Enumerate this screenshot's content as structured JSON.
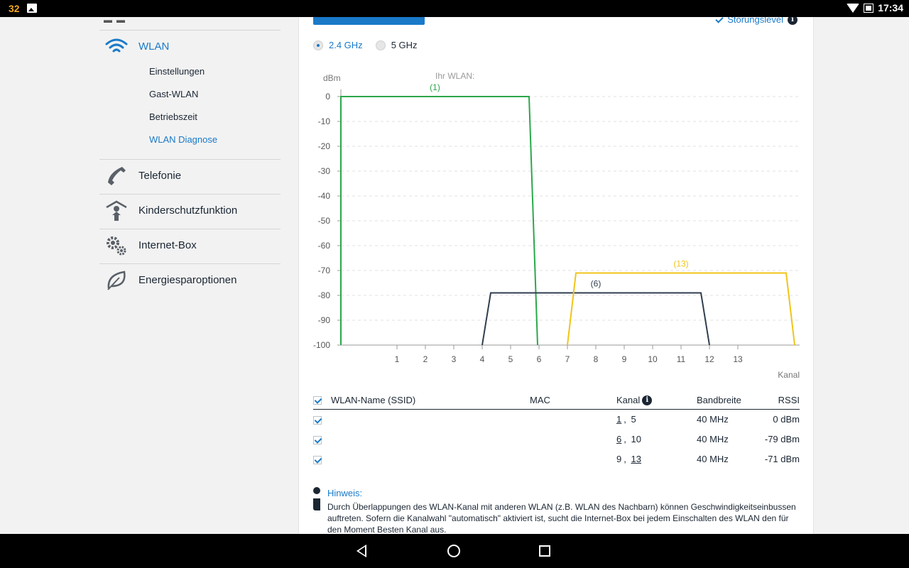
{
  "status_bar": {
    "notification_count": "32",
    "time": "17:34"
  },
  "sidebar": {
    "wlan": {
      "label": "WLAN",
      "sub_items": [
        {
          "label": "Einstellungen"
        },
        {
          "label": "Gast-WLAN"
        },
        {
          "label": "Betriebszeit"
        },
        {
          "label": "WLAN Diagnose",
          "active": true
        }
      ]
    },
    "items": [
      {
        "label": "Telefonie",
        "icon": "phone-icon"
      },
      {
        "label": "Kinderschutzfunktion",
        "icon": "child-protection-icon"
      },
      {
        "label": "Internet-Box",
        "icon": "gears-icon"
      },
      {
        "label": "Energiesparoptionen",
        "icon": "leaf-icon"
      }
    ]
  },
  "main": {
    "interference_label": "Störungslevel",
    "bands": [
      {
        "label": "2.4 GHz",
        "checked": true
      },
      {
        "label": "5 GHz",
        "checked": false
      }
    ],
    "table": {
      "headers": {
        "ssid": "WLAN-Name (SSID)",
        "mac": "MAC",
        "kanal": "Kanal",
        "bandwidth": "Bandbreite",
        "rssi": "RSSI"
      },
      "rows": [
        {
          "ssid": "",
          "mac": "",
          "channel_primary": "1",
          "channel_secondary": "5",
          "primary_first": true,
          "bandwidth": "40 MHz",
          "rssi": "0 dBm"
        },
        {
          "ssid": "",
          "mac": "",
          "channel_primary": "6",
          "channel_secondary": "10",
          "primary_first": true,
          "bandwidth": "40 MHz",
          "rssi": "-79 dBm"
        },
        {
          "ssid": "",
          "mac": "",
          "channel_primary": "13",
          "channel_secondary": "9",
          "primary_first": false,
          "bandwidth": "40 MHz",
          "rssi": "-71 dBm"
        }
      ]
    },
    "hint": {
      "title": "Hinweis:",
      "text": "Durch Überlappungen des WLAN-Kanal mit anderen WLAN (z.B. WLAN des Nachbarn) können Geschwindigkeitseinbussen auftreten. Sofern die Kanalwahl \"automatisch\" aktiviert ist, sucht die Internet-Box bei jedem Einschalten des WLAN den für den Moment Besten Kanal aus."
    }
  },
  "chart_data": {
    "type": "line",
    "ylabel": "dBm",
    "xlabel": "Kanal",
    "own_wlan_label": "Ihr WLAN:",
    "ylim": [
      -100,
      0
    ],
    "yticks": [
      0,
      -10,
      -20,
      -30,
      -40,
      -50,
      -60,
      -70,
      -80,
      -90,
      -100
    ],
    "xticks": [
      1,
      2,
      3,
      4,
      5,
      6,
      7,
      8,
      9,
      10,
      11,
      12,
      13
    ],
    "grid": "horizontal-dashed",
    "series": [
      {
        "name": "(1)",
        "color": "#2aa84a",
        "points": [
          [
            -2,
            -100
          ],
          [
            -1.75,
            0
          ],
          [
            5.65,
            0
          ],
          [
            5.95,
            -100
          ]
        ]
      },
      {
        "name": "(6)",
        "color": "#2f3e4f",
        "points": [
          [
            4,
            -100
          ],
          [
            4.3,
            -79
          ],
          [
            11.7,
            -79
          ],
          [
            12,
            -100
          ]
        ]
      },
      {
        "name": "(13)",
        "color": "#f0c419",
        "points": [
          [
            7,
            -100
          ],
          [
            7.3,
            -71
          ],
          [
            14.7,
            -71
          ],
          [
            15,
            -100
          ]
        ]
      }
    ]
  }
}
